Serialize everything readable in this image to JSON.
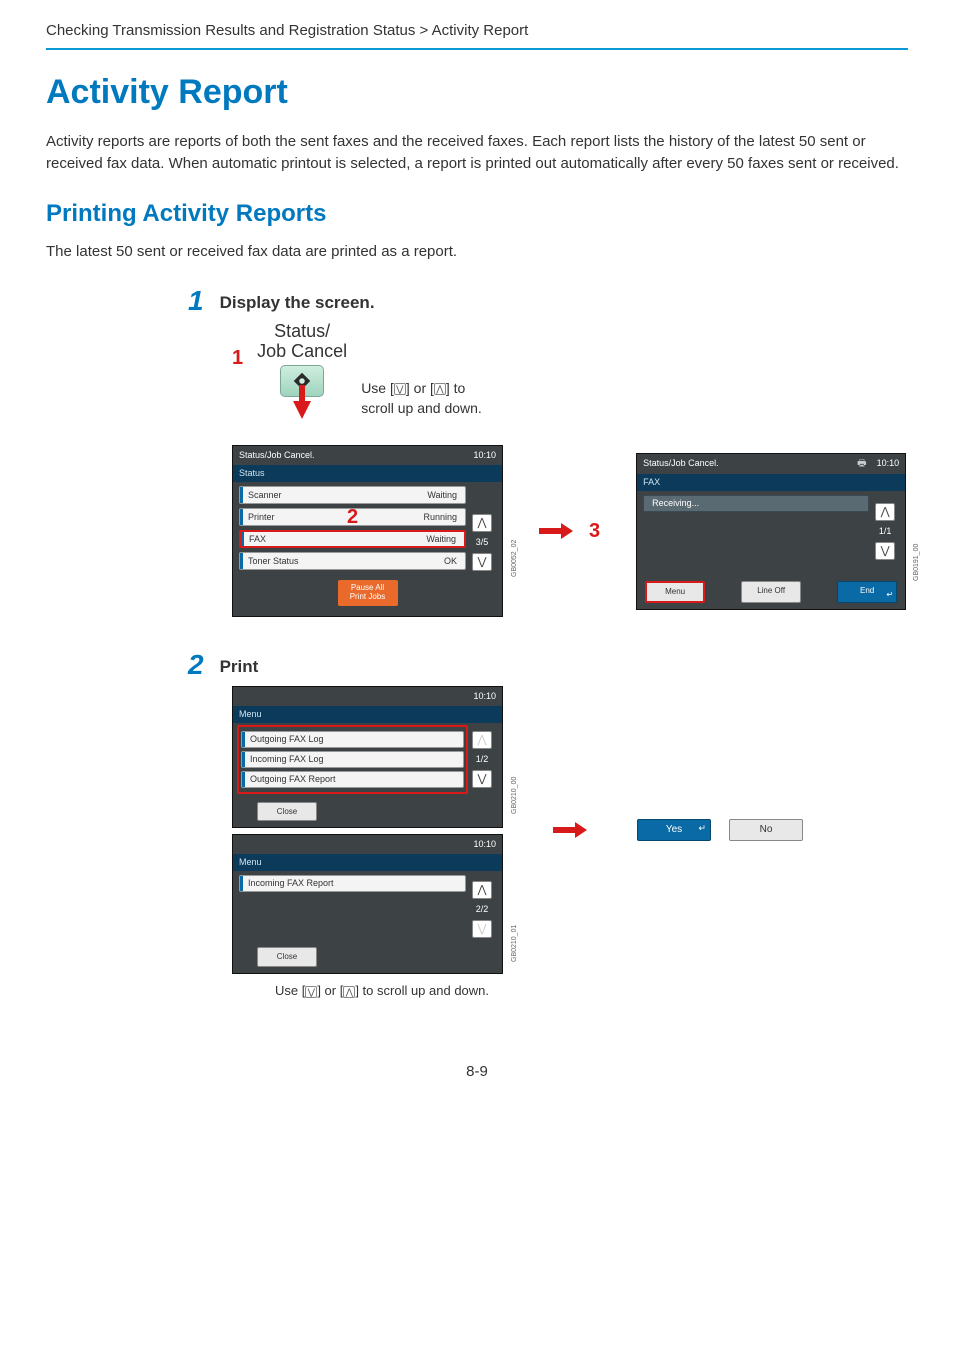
{
  "breadcrumb": "Checking Transmission Results and Registration Status > Activity Report",
  "h1": "Activity Report",
  "intro": "Activity reports are reports of both the sent faxes and the received faxes. Each report lists the history of the latest 50 sent or received fax data. When automatic printout is selected, a report is printed out automatically after every 50 faxes sent or received.",
  "h2": "Printing Activity Reports",
  "subintro": "The latest 50 sent or received fax data are printed as a report.",
  "step1": {
    "num": "1",
    "title": "Display the screen.",
    "callout1": "1",
    "hardkey_line1": "Status/",
    "hardkey_line2": "Job Cancel",
    "scroll_line1": "Use [",
    "scroll_line2": "] or [",
    "scroll_line3": "] to",
    "scroll_line4": "scroll up and down.",
    "callout2": "2",
    "callout3": "3",
    "lcd_left": {
      "title": "Status/Job Cancel.",
      "time": "10:10",
      "subhead": "Status",
      "rows": [
        {
          "label": "Scanner",
          "status": "Waiting"
        },
        {
          "label": "Printer",
          "status": "Running"
        },
        {
          "label": "FAX",
          "status": "Waiting"
        },
        {
          "label": "Toner Status",
          "status": "OK"
        }
      ],
      "pager": "3/5",
      "footer_btn": "Pause All\nPrint Jobs",
      "sidecode": "GB0052_02"
    },
    "lcd_right": {
      "title": "Status/Job Cancel.",
      "time": "10:10",
      "subhead": "FAX",
      "row1": "Receiving...",
      "pager": "1/1",
      "footer": {
        "menu": "Menu",
        "lineoff": "Line Off",
        "end": "End"
      },
      "sidecode": "GB0191_00"
    }
  },
  "step2": {
    "num": "2",
    "title": "Print",
    "lcdA": {
      "time": "10:10",
      "subhead": "Menu",
      "items": [
        "Outgoing FAX Log",
        "Incoming FAX Log",
        "Outgoing FAX Report"
      ],
      "pager": "1/2",
      "close": "Close",
      "sidecode": "GB0210_00"
    },
    "lcdB": {
      "time": "10:10",
      "subhead": "Menu",
      "items": [
        "Incoming FAX Report"
      ],
      "pager": "2/2",
      "close": "Close",
      "sidecode": "GB0210_01"
    },
    "yes": "Yes",
    "no": "No",
    "chev_caption_pre": "Use [",
    "chev_caption_mid": "] or [",
    "chev_caption_post": "] to scroll up and down."
  },
  "page_number": "8-9"
}
